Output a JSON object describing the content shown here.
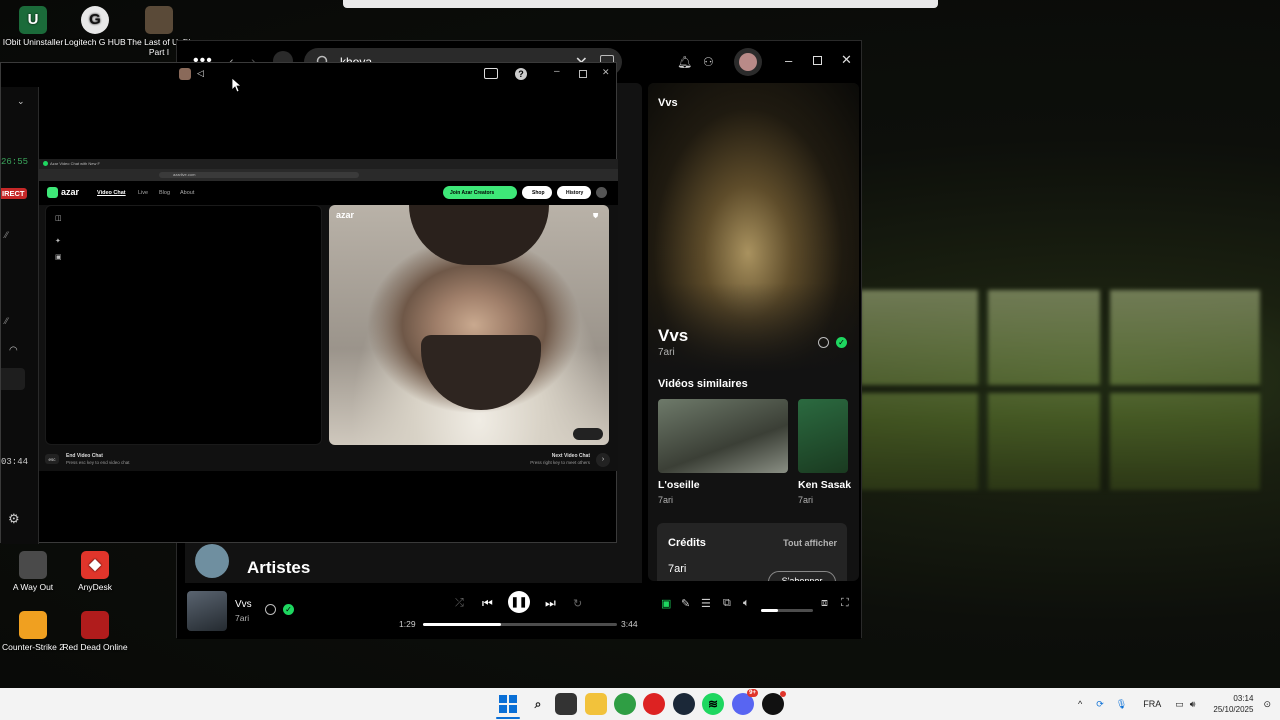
{
  "desktop": {
    "top_icons": [
      {
        "label": "IObit Uninstaller",
        "icon": "iobit-icon",
        "color": "#1b6b3a"
      },
      {
        "label": "Logitech G HUB",
        "icon": "logitech-icon",
        "color": "#e8e8e8"
      },
      {
        "label": "The Last of Us™ Part I",
        "icon": "tlou-icon",
        "color": "#5a4a38"
      }
    ],
    "bottom_icons": [
      {
        "label": "A Way Out",
        "icon": "awayout-icon",
        "color": "#4a4a4a"
      },
      {
        "label": "AnyDesk",
        "icon": "anydesk-icon",
        "color": "#e0352b"
      },
      {
        "label": "Counter-Strike 2",
        "icon": "cs2-icon",
        "color": "#f0a020"
      },
      {
        "label": "Red Dead Online",
        "icon": "rdo-icon",
        "color": "#b01c1c"
      }
    ]
  },
  "spotify": {
    "search_value": "khova",
    "now_playing_panel": {
      "header": "Vvs",
      "title": "Vvs",
      "artist": "7ari",
      "similar_heading": "Vidéos similaires",
      "similar": [
        {
          "title": "L'oseille",
          "artist": "7ari"
        },
        {
          "title": "Ken Sasak",
          "artist": "7ari"
        }
      ],
      "credits_heading": "Crédits",
      "credits_show_all": "Tout afficher",
      "credits_artist": "7ari",
      "credits_follow": "S'abonner"
    },
    "artists_heading": "Artistes",
    "player": {
      "track": "Vvs",
      "artist": "7ari",
      "elapsed": "1:29",
      "duration": "3:44",
      "progress_fraction": 0.4,
      "volume_fraction": 0.33
    }
  },
  "azar_window": {
    "left_strip": {
      "time_top": "26:55",
      "badge": "IRECT",
      "time_bottom": "03:44"
    },
    "browser": {
      "tab_title": "Azar Video Chat with New F",
      "url": "azarlive.com",
      "logo": "azar",
      "nav_links": [
        "Video Chat",
        "Live",
        "Blog",
        "About"
      ],
      "join_button": "Join Azar Creators",
      "shop_button": "Shop",
      "history_button": "History",
      "video_logo": "azar",
      "end_chat_key": "esc",
      "end_chat_title": "End Video Chat",
      "end_chat_hint": "Press esc key to end video chat",
      "next_chat_title": "Next Video Chat",
      "next_chat_hint": "Press right key to meet others"
    }
  },
  "taskbar": {
    "language": "FRA",
    "time": "03:14",
    "date": "25/10/2025",
    "discord_badge": "9+"
  }
}
